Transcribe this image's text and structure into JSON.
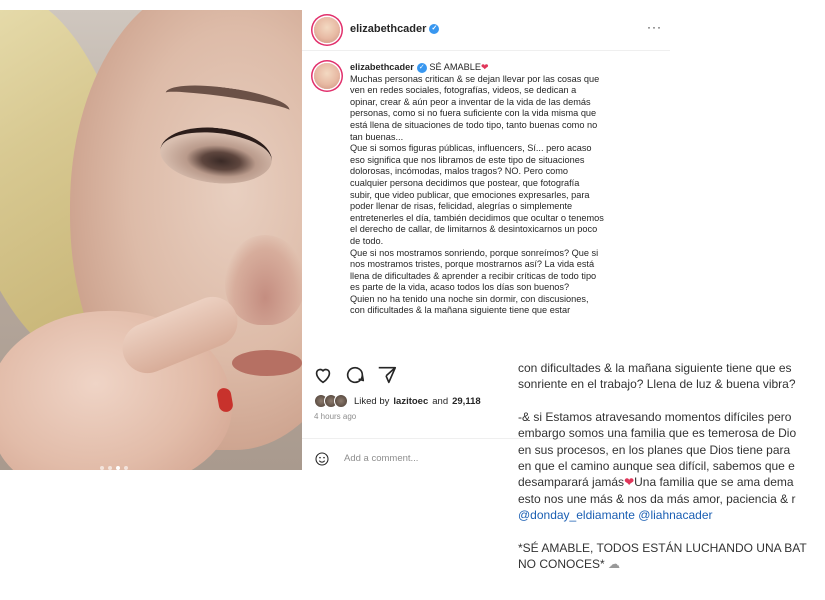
{
  "post": {
    "username": "elizabethcader",
    "caption_title": "SÉ AMABLE",
    "caption_lines": [
      "Muchas personas critican & se dejan llevar por las cosas que",
      "ven en redes sociales, fotografías, videos, se dedican a",
      "opinar, crear & aún peor a inventar de la vida de las demás",
      "personas, como si no fuera suficiente con la vida misma que",
      "está llena de situaciones de todo tipo, tanto buenas como no",
      "tan buenas...",
      "Que si somos figuras públicas, influencers, Sí... pero acaso",
      "eso significa que nos libramos de este tipo de situaciones",
      "dolorosas, incómodas, malos tragos? NO. Pero como",
      "cualquier persona decidimos que postear, que fotografía",
      "subir, que video publicar, que emociones expresarles, para",
      "poder llenar de risas, felicidad, alegrías o simplemente",
      "entretenerles el día, también decidimos que ocultar o tenemos",
      "el derecho de callar, de limitarnos & desintoxicarnos un poco",
      "de todo.",
      "Que si nos mostramos sonriendo, porque sonreímos? Que si",
      "nos mostramos tristes, porque mostrarnos así? La vida está",
      "llena de dificultades & aprender a recibir críticas de todo tipo",
      "es parte de la vida, acaso todos los días son buenos?",
      "Quien no ha tenido una noche sin dormir, con discusiones,",
      "con dificultades & la mañana siguiente tiene que estar"
    ],
    "liked_by_prefix": "Liked by",
    "liked_by_user": "lazitoec",
    "liked_by_and": "and",
    "likes_count": "29,118",
    "time_ago": "4 hours ago",
    "add_comment_placeholder": "Add a comment...",
    "more_label": "···"
  },
  "continuation": {
    "lines": [
      "con dificultades & la mañana siguiente tiene que es",
      "sonriente en el trabajo? Llena de luz & buena vibra?",
      "",
      "-& si Estamos atravesando momentos difíciles pero",
      "embargo somos una familia que es temerosa de Dio",
      "en sus procesos, en los planes que Dios tiene para",
      "en que el camino aunque sea difícil, sabemos que e",
      "desamparará jamás",
      "esto nos une más & nos da más amor, paciencia & r"
    ],
    "line8_suffix": "Una familia que se ama dema",
    "mentions": "@donday_eldiamante @liahnacader",
    "closing_line1": "*SÉ AMABLE, TODOS ESTÁN LUCHANDO UNA BAT",
    "closing_line2": "NO CONOCES*"
  },
  "colors": {
    "verified": "#3897f0",
    "heart": "#e0365a",
    "mention": "#1b5fb3",
    "muted": "#8e8e8e"
  },
  "icons": [
    "heart-icon",
    "comment-icon",
    "share-icon",
    "smile-icon",
    "verified-icon",
    "more-icon"
  ]
}
